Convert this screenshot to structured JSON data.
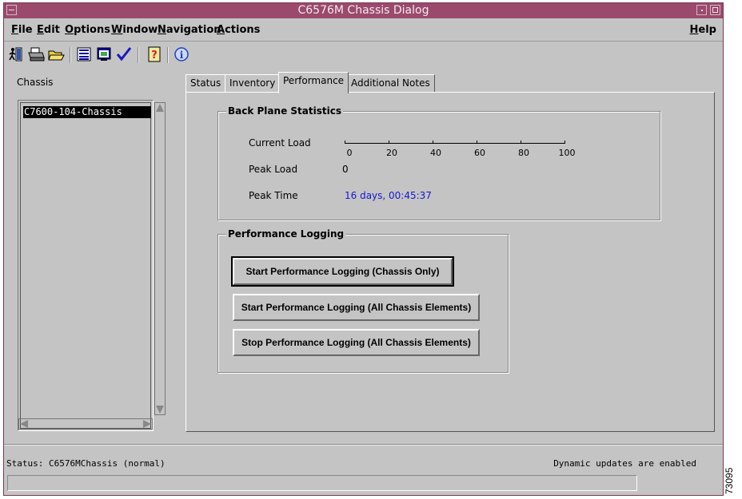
{
  "window": {
    "title": "C6576M Chassis Dialog"
  },
  "menubar": {
    "items": [
      {
        "label": "File",
        "mnemonic": "F",
        "rest": "ile"
      },
      {
        "label": "Edit",
        "mnemonic": "E",
        "rest": "dit"
      },
      {
        "label": "Options",
        "mnemonic": "O",
        "rest": "ptions"
      },
      {
        "label": "Window",
        "mnemonic": "W",
        "rest": "indow"
      },
      {
        "label": "Navigation",
        "mnemonic": "N",
        "rest": "avigation"
      },
      {
        "label": "Actions",
        "mnemonic": "A",
        "rest": "ctions"
      }
    ],
    "help": {
      "label": "Help",
      "mnemonic": "H",
      "rest": "elp"
    }
  },
  "toolbar": {
    "icons": [
      "exit-icon",
      "printer-icon",
      "open-folder-icon",
      "list-view-icon",
      "properties-icon",
      "apply-check-icon",
      "help-icon",
      "info-icon"
    ]
  },
  "chassis": {
    "label": "Chassis",
    "items": [
      "C7600-104-Chassis"
    ],
    "selected_index": 0
  },
  "tabs": [
    {
      "label": "Status",
      "active": false
    },
    {
      "label": "Inventory",
      "active": false
    },
    {
      "label": "Performance",
      "active": true
    },
    {
      "label": "Additional Notes",
      "active": false
    }
  ],
  "backplane": {
    "title": "Back Plane Statistics",
    "current_load_label": "Current Load",
    "scale_ticks": [
      "0",
      "20",
      "40",
      "60",
      "80",
      "100"
    ],
    "current_load_value": 0,
    "peak_load_label": "Peak Load",
    "peak_load_value": "0",
    "peak_time_label": "Peak Time",
    "peak_time_value": "16 days, 00:45:37",
    "peak_time_color": "#1818d0"
  },
  "logging": {
    "title": "Performance Logging",
    "start_chassis_only": "Start Performance Logging (Chassis Only)",
    "start_all": "Start Performance Logging (All Chassis Elements)",
    "stop_all": "Stop Performance Logging (All Chassis Elements)"
  },
  "status": {
    "left": "Status: C6576MChassis (normal)",
    "right": "Dynamic updates are enabled",
    "field_value": ""
  },
  "figure_code": "73095"
}
